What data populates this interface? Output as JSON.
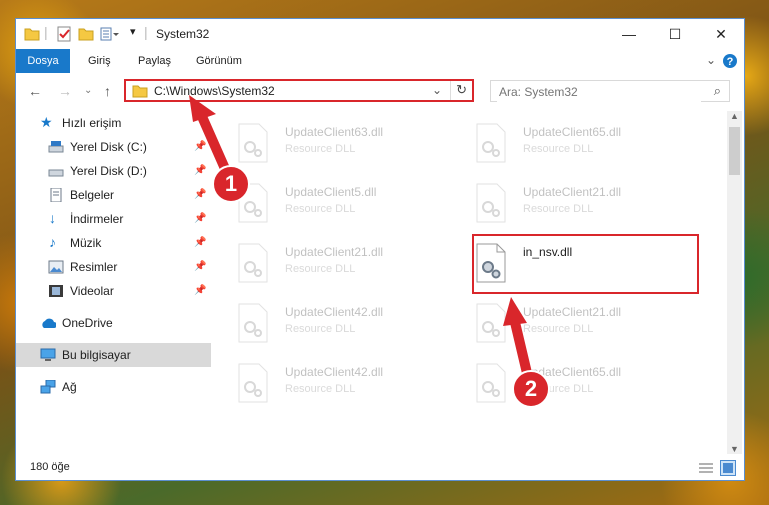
{
  "window": {
    "title": "System32",
    "controls": {
      "minimize": "—",
      "maximize": "☐",
      "close": "✕"
    }
  },
  "ribbon": {
    "tabs": [
      {
        "label": "Dosya",
        "active": true
      },
      {
        "label": "Giriş"
      },
      {
        "label": "Paylaş"
      },
      {
        "label": "Görünüm"
      }
    ],
    "expand_icon": "chevron-down-icon",
    "help_icon": "help-icon"
  },
  "address": {
    "path": "C:\\Windows\\System32",
    "highlight_color": "#d9262b"
  },
  "search": {
    "placeholder": "Ara: System32"
  },
  "sidebar": {
    "items": [
      {
        "label": "Hızlı erişim",
        "icon": "star-icon",
        "pinned": false
      },
      {
        "label": "Yerel Disk (C:)",
        "icon": "drive-icon",
        "pinned": true
      },
      {
        "label": "Yerel Disk (D:)",
        "icon": "drive-icon",
        "pinned": true
      },
      {
        "label": "Belgeler",
        "icon": "documents-icon",
        "pinned": true
      },
      {
        "label": "İndirmeler",
        "icon": "download-icon",
        "pinned": true
      },
      {
        "label": "Müzik",
        "icon": "music-icon",
        "pinned": true
      },
      {
        "label": "Resimler",
        "icon": "pictures-icon",
        "pinned": true
      },
      {
        "label": "Videolar",
        "icon": "videos-icon",
        "pinned": true
      },
      {
        "label": "OneDrive",
        "icon": "cloud-icon"
      },
      {
        "label": "Bu bilgisayar",
        "icon": "computer-icon",
        "selected": true
      },
      {
        "label": "Ağ",
        "icon": "network-icon"
      }
    ]
  },
  "files": [
    {
      "name": "UpdateClient63.dll",
      "type": "Resource DLL",
      "faded": true
    },
    {
      "name": "UpdateClient65.dll",
      "type": "Resource DLL",
      "faded": true
    },
    {
      "name": "UpdateClient5.dll",
      "type": "Resource DLL",
      "faded": true
    },
    {
      "name": "UpdateClient21.dll",
      "type": "Resource DLL",
      "faded": true
    },
    {
      "name": "UpdateClient21.dll",
      "type": "Resource DLL",
      "faded": true
    },
    {
      "name": "in_nsv.dll",
      "type": "",
      "faded": false
    },
    {
      "name": "UpdateClient42.dll",
      "type": "Resource DLL",
      "faded": true
    },
    {
      "name": "UpdateClient21.dll",
      "type": "Resource DLL",
      "faded": true
    },
    {
      "name": "UpdateClient42.dll",
      "type": "Resource DLL",
      "faded": true
    },
    {
      "name": "UpdateClient65.dll",
      "type": "Resource DLL",
      "faded": true
    }
  ],
  "status": {
    "count": "180 öğe"
  },
  "annotations": {
    "step1": "1",
    "step2": "2",
    "color": "#d9262b"
  }
}
